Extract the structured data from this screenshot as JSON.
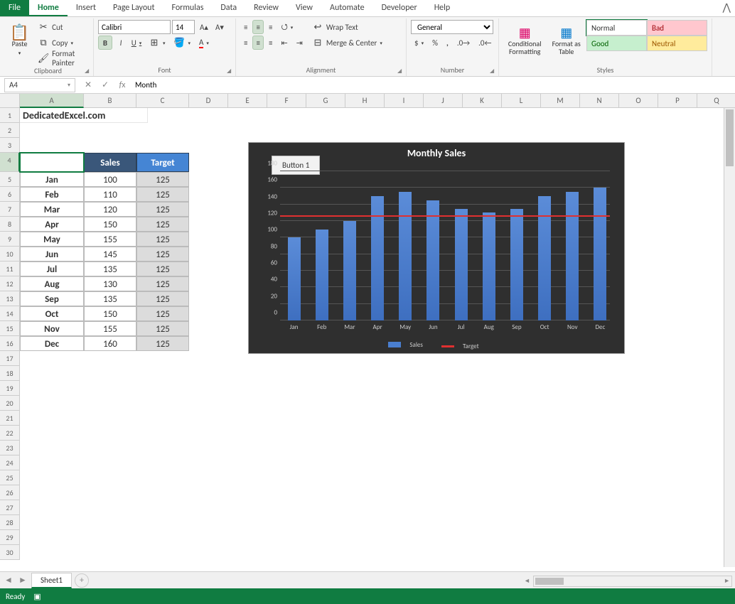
{
  "tabs": [
    "File",
    "Home",
    "Insert",
    "Page Layout",
    "Formulas",
    "Data",
    "Review",
    "View",
    "Automate",
    "Developer",
    "Help"
  ],
  "active_tab": "Home",
  "clipboard": {
    "paste": "Paste",
    "cut": "Cut",
    "copy": "Copy",
    "fp": "Format Painter",
    "label": "Clipboard"
  },
  "font": {
    "name": "Calibri",
    "size": "14",
    "label": "Font"
  },
  "alignment": {
    "wrap": "Wrap Text",
    "merge": "Merge & Center",
    "label": "Alignment"
  },
  "number": {
    "format": "General",
    "label": "Number"
  },
  "styles": {
    "cf": "Conditional Formatting",
    "fat": "Format as Table",
    "normal": "Normal",
    "bad": "Bad",
    "good": "Good",
    "neutral": "Neutral",
    "label": "Styles"
  },
  "namebox": "A4",
  "formula": "Month",
  "sheet": {
    "name": "Sheet1"
  },
  "status": "Ready",
  "a1": "DedicatedExcel.com",
  "columns": [
    "A",
    "B",
    "C",
    "D",
    "E",
    "F",
    "G",
    "H",
    "I",
    "J",
    "K",
    "L",
    "M",
    "N",
    "O",
    "P",
    "Q"
  ],
  "col_widths": {
    "A": 90,
    "B": 74,
    "C": 74,
    "D": 55,
    "E": 55,
    "F": 55,
    "G": 55,
    "H": 55,
    "I": 55,
    "J": 55,
    "K": 55,
    "L": 55,
    "M": 55,
    "N": 55,
    "O": 55,
    "P": 55,
    "Q": 55
  },
  "row_count": 30,
  "headers": [
    "Month",
    "Sales",
    "Target"
  ],
  "data": [
    [
      "Jan",
      100,
      125
    ],
    [
      "Feb",
      110,
      125
    ],
    [
      "Mar",
      120,
      125
    ],
    [
      "Apr",
      150,
      125
    ],
    [
      "May",
      155,
      125
    ],
    [
      "Jun",
      145,
      125
    ],
    [
      "Jul",
      135,
      125
    ],
    [
      "Aug",
      130,
      125
    ],
    [
      "Sep",
      135,
      125
    ],
    [
      "Oct",
      150,
      125
    ],
    [
      "Nov",
      155,
      125
    ],
    [
      "Dec",
      160,
      125
    ]
  ],
  "chart_data": {
    "type": "bar",
    "title": "Monthly Sales",
    "categories": [
      "Jan",
      "Feb",
      "Mar",
      "Apr",
      "May",
      "Jun",
      "Jul",
      "Aug",
      "Sep",
      "Oct",
      "Nov",
      "Dec"
    ],
    "series": [
      {
        "name": "Sales",
        "values": [
          100,
          110,
          120,
          150,
          155,
          145,
          135,
          130,
          135,
          150,
          155,
          160
        ],
        "color": "#4a7fd0"
      },
      {
        "name": "Target",
        "values": [
          125,
          125,
          125,
          125,
          125,
          125,
          125,
          125,
          125,
          125,
          125,
          125
        ],
        "color": "#e03030",
        "render": "line"
      }
    ],
    "ylim": [
      0,
      180
    ],
    "ystep": 20,
    "button": "Button 1",
    "legend": [
      "Sales",
      "Target"
    ]
  }
}
